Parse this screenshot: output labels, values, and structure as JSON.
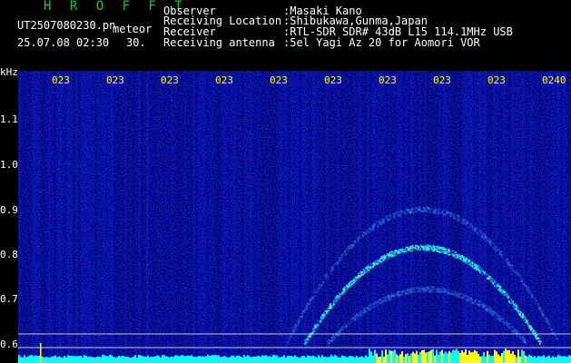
{
  "app": {
    "brand": "H R O F F T",
    "filename": "UT2507080230.pn",
    "mode": "meteor",
    "datetime": "25.07.08 02:30",
    "interval": "30."
  },
  "info": {
    "rows": [
      {
        "label": "Observer",
        "value": ":Masaki Kano"
      },
      {
        "label": "Receiving Location",
        "value": ":Shibukawa,Gunma,Japan"
      },
      {
        "label": "Receiver",
        "value": ":RTL-SDR SDR# 43dB L15 114.1MHz USB"
      },
      {
        "label": "Receiving antenna",
        "value": ":5el Yagi Az 20 for Aomori VOR"
      }
    ]
  },
  "axis": {
    "unit": "kHz",
    "y_labels": [
      "1.1",
      "1.0",
      "0.9",
      "0.8",
      "0.7",
      "0.6"
    ],
    "time_labels": [
      "023",
      "023",
      "023",
      "023",
      "023",
      "023",
      "023",
      "023",
      "023",
      "0240"
    ]
  },
  "colors": {
    "background": "#000000",
    "spectrum_base": "#00008a",
    "signal": "#00ffff",
    "hot": "#ffff00",
    "brand_green": "#23c23a"
  }
}
